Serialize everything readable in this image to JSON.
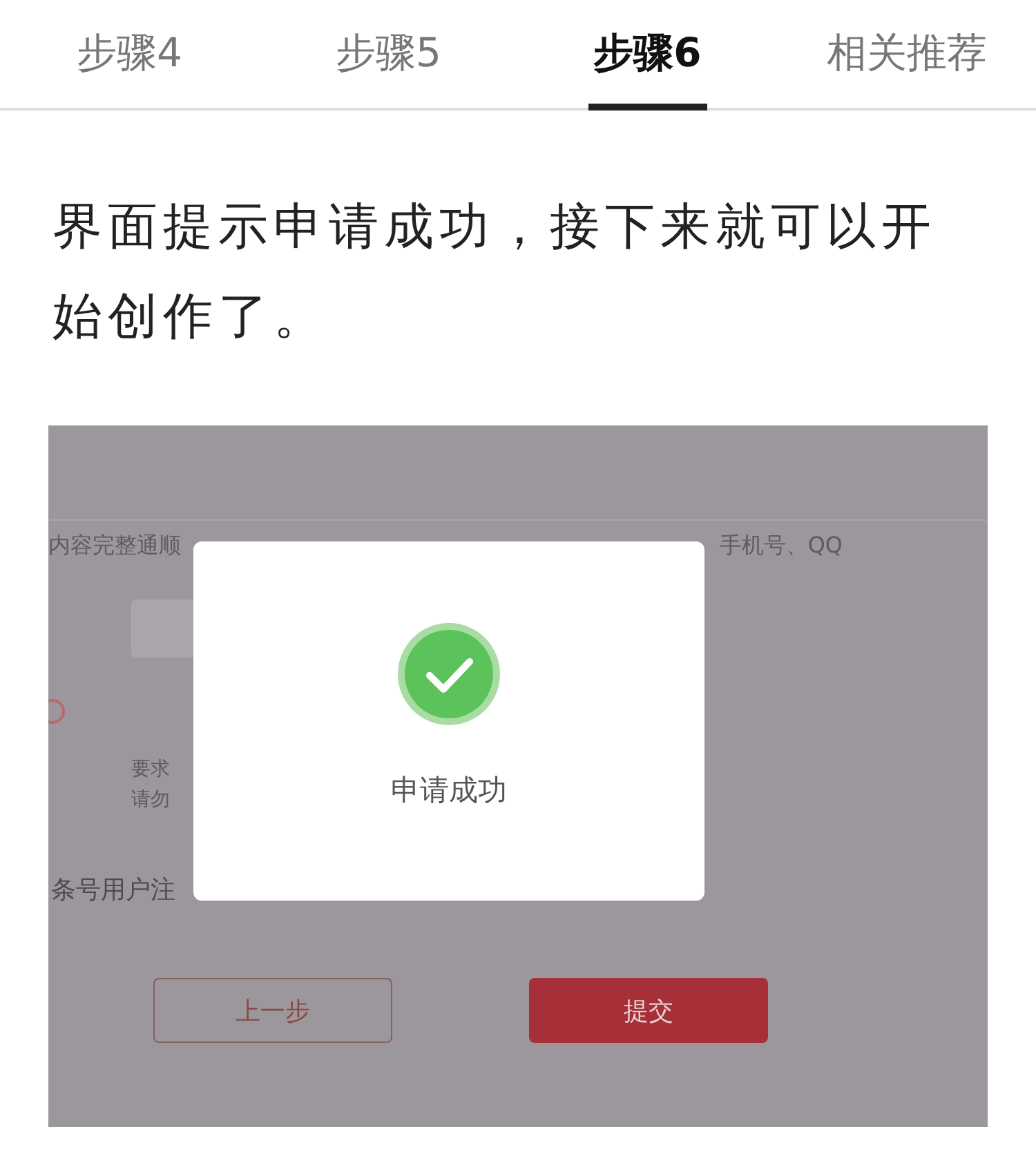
{
  "tabs": [
    {
      "label": "步骤4",
      "selected": false
    },
    {
      "label": "步骤5",
      "selected": false
    },
    {
      "label": "步骤6",
      "selected": true
    },
    {
      "label": "相关推荐",
      "selected": false
    }
  ],
  "step_text": "界面提示申请成功，接下来就可以开始创作了。",
  "screenshot": {
    "form_hint_left": "内容完整通顺",
    "form_hint_right": "手机号、QQ",
    "note_lines": [
      "要求",
      "请勿"
    ],
    "agreement_text": "条号用户注",
    "buttons": [
      {
        "label": "上一步",
        "kind": "secondary"
      },
      {
        "label": "提交",
        "kind": "primary"
      }
    ],
    "dialog": {
      "message": "申请成功"
    }
  }
}
